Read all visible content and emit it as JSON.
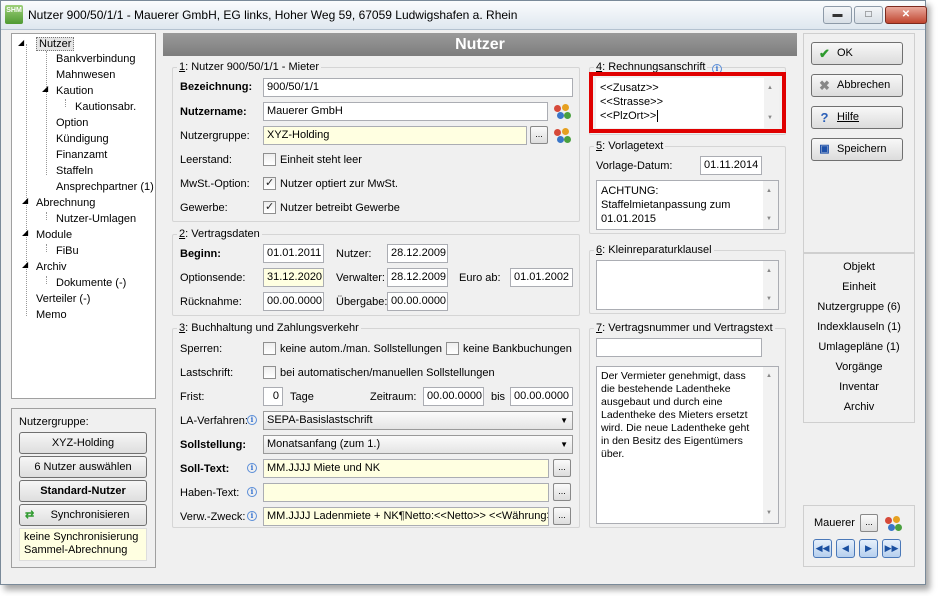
{
  "window": {
    "title": "Nutzer 900/50/1/1 - Mauerer GmbH, EG links, Hoher Weg 59, 67059 Ludwigshafen a. Rhein",
    "app_icon_text": "SHM"
  },
  "tree": [
    {
      "label": "Nutzer"
    },
    {
      "label": "Bankverbindung"
    },
    {
      "label": "Mahnwesen"
    },
    {
      "label": "Kaution"
    },
    {
      "label": "Kautionsabr."
    },
    {
      "label": "Option"
    },
    {
      "label": "Kündigung"
    },
    {
      "label": "Finanzamt"
    },
    {
      "label": "Staffeln"
    },
    {
      "label": "Ansprechpartner (1)"
    },
    {
      "label": "Abrechnung"
    },
    {
      "label": "Nutzer-Umlagen"
    },
    {
      "label": "Module"
    },
    {
      "label": "FiBu"
    },
    {
      "label": "Archiv"
    },
    {
      "label": "Dokumente (-)"
    },
    {
      "label": "Verteiler (-)"
    },
    {
      "label": "Memo"
    }
  ],
  "left_bottom": {
    "group_label": "Nutzergruppe:",
    "group_button": "XYZ-Holding",
    "select_button": "6 Nutzer auswählen",
    "standard_button": "Standard-Nutzer",
    "sync_button": "Synchronisieren",
    "note_line1": "keine Synchronisierung",
    "note_line2": "Sammel-Abrechnung"
  },
  "header": {
    "title": "Nutzer"
  },
  "section1": {
    "title_num": "1",
    "title": ": Nutzer 900/50/1/1 - Mieter",
    "bezeichnung_label": "Bezeichnung:",
    "bezeichnung": "900/50/1/1",
    "nutzername_label": "Nutzername:",
    "nutzername": "Mauerer GmbH",
    "nutzergruppe_label": "Nutzergruppe:",
    "nutzergruppe": "XYZ-Holding",
    "leerstand_label": "Leerstand:",
    "leerstand_text": "Einheit steht leer",
    "mwst_label": "MwSt.-Option:",
    "mwst_text": "Nutzer optiert zur MwSt.",
    "gewerbe_label": "Gewerbe:",
    "gewerbe_text": "Nutzer betreibt Gewerbe",
    "browse": "..."
  },
  "section2": {
    "title_num": "2",
    "title": ": Vertragsdaten",
    "beginn_label": "Beginn:",
    "beginn": "01.01.2011",
    "nutzer_label": "Nutzer:",
    "nutzer": "28.12.2009",
    "optionsende_label": "Optionsende:",
    "optionsende": "31.12.2020",
    "verwalter_label": "Verwalter:",
    "verwalter": "28.12.2009",
    "euro_label": "Euro ab:",
    "euro": "01.01.2002",
    "ruecknahme_label": "Rücknahme:",
    "ruecknahme": "00.00.0000",
    "uebergabe_label": "Übergabe:",
    "uebergabe": "00.00.0000"
  },
  "section3": {
    "title_num": "3",
    "title": ": Buchhaltung und Zahlungsverkehr",
    "sperren_label": "Sperren:",
    "sperren1": "keine autom./man. Sollstellungen",
    "sperren2": "keine Bankbuchungen",
    "lastschrift_label": "Lastschrift:",
    "lastschrift_text": "bei automatischen/manuellen Sollstellungen",
    "frist_label": "Frist:",
    "frist": "0",
    "tage": "Tage",
    "zeitraum_label": "Zeitraum:",
    "zeitraum_von": "00.00.0000",
    "bis": "bis",
    "zeitraum_bis": "00.00.0000",
    "la_label": "LA-Verfahren:",
    "la": "SEPA-Basislastschrift",
    "soll_label": "Sollstellung:",
    "soll": "Monatsanfang (zum 1.)",
    "solltext_label": "Soll-Text:",
    "solltext": "MM.JJJJ Miete und NK",
    "habentext_label": "Haben-Text:",
    "habentext": "",
    "verw_label": "Verw.-Zweck:",
    "verw": "MM.JJJJ Ladenmiete + NK¶Netto:<<Netto>> <<Währung>>"
  },
  "section4": {
    "title_num": "4",
    "title": ": Rechnungsanschrift",
    "line1": "<<Zusatz>>",
    "line2": "<<Strasse>>",
    "line3": "<<PlzOrt>>"
  },
  "section5": {
    "title_num": "5",
    "title": ": Vorlagetext",
    "datum_label": "Vorlage-Datum:",
    "datum": "01.11.2014",
    "text1": "ACHTUNG:",
    "text2": "Staffelmietanpassung zum",
    "text3": "01.01.2015"
  },
  "section6": {
    "title_num": "6",
    "title": ": Kleinreparaturklausel"
  },
  "section7": {
    "title_num": "7",
    "title": ": Vertragsnummer und Vertragstext",
    "nummer": "",
    "l1": "Der Vermieter genehmigt, dass",
    "l2": "die bestehende Ladentheke",
    "l3": "ausgebaut und durch eine",
    "l4": "Ladentheke des Mieters ersetzt",
    "l5": "wird. Die neue Ladentheke geht",
    "l6": "in den Besitz des Eigentümers",
    "l7": "über."
  },
  "actions": {
    "ok": "OK",
    "cancel": "Abbrechen",
    "help": "Hilfe",
    "save": "Speichern"
  },
  "links": [
    "Objekt",
    "Einheit",
    "Nutzergruppe (6)",
    "Indexklauseln (1)",
    "Umlagepläne (1)",
    "Vorgänge",
    "Inventar",
    "Archiv"
  ],
  "footer": {
    "name": "Mauerer",
    "browse": "..."
  },
  "colors": {
    "header_bg": "#8a8a8a",
    "yellow_field": "#ffffe1",
    "highlight": "#e00000"
  }
}
